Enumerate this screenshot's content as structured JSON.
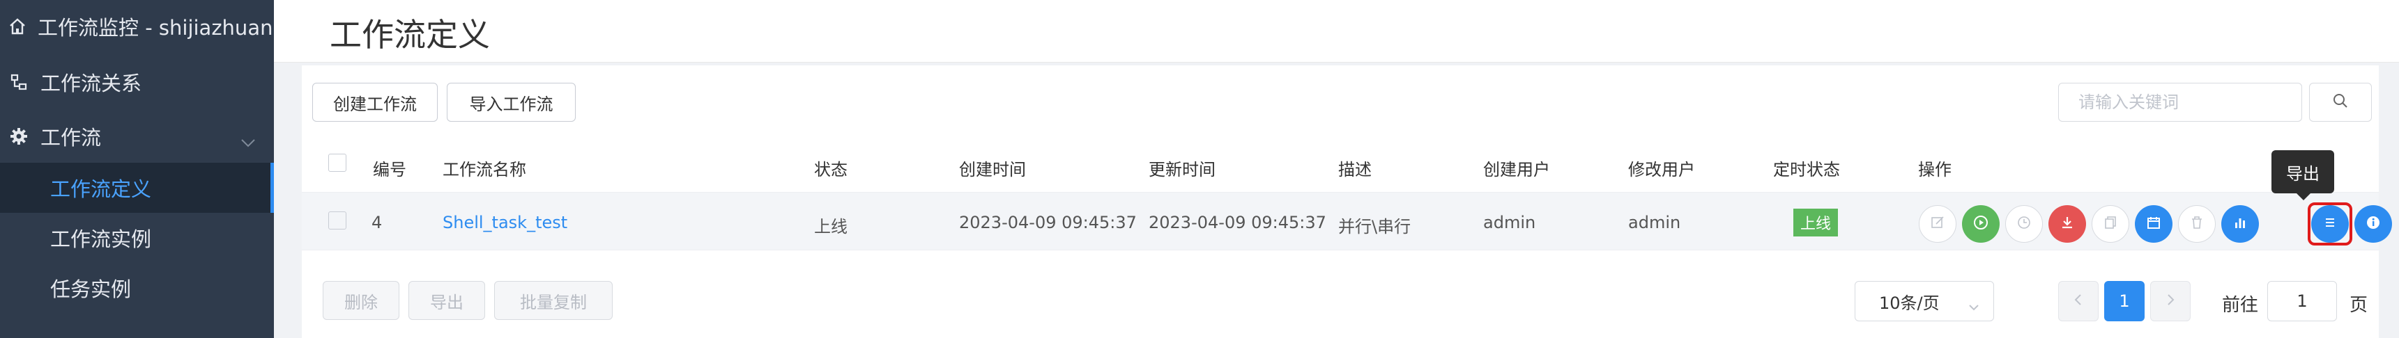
{
  "sidebar": {
    "items": [
      {
        "label": "工作流监控 - shijiazhuan…",
        "icon": "home-icon"
      },
      {
        "label": "工作流关系",
        "icon": "relation-icon"
      },
      {
        "label": "工作流",
        "icon": "gear-icon"
      },
      {
        "label": "工作流定义",
        "active": true
      },
      {
        "label": "工作流实例"
      },
      {
        "label": "任务实例"
      }
    ]
  },
  "page": {
    "title": "工作流定义"
  },
  "toolbar": {
    "create_label": "创建工作流",
    "import_label": "导入工作流",
    "search_placeholder": "请输入关键词"
  },
  "table": {
    "headers": [
      "编号",
      "工作流名称",
      "状态",
      "创建时间",
      "更新时间",
      "描述",
      "创建用户",
      "修改用户",
      "定时状态",
      "操作"
    ],
    "rows": [
      {
        "id": "4",
        "name": "Shell_task_test",
        "status": "上线",
        "created": "2023-04-09 09:45:37",
        "updated": "2023-04-09 09:45:37",
        "description": "并行\\串行",
        "creator": "admin",
        "modifier": "admin",
        "schedule_status": "上线"
      }
    ]
  },
  "actions": {
    "tooltip": "导出",
    "icons": [
      "edit-icon",
      "run-icon",
      "timer-icon",
      "offline-icon",
      "copy-icon",
      "schedule-icon",
      "delete-icon",
      "tree-icon",
      "export-icon",
      "info-icon"
    ],
    "colors": {
      "green": "#5cb85c",
      "red": "#e55353",
      "blue": "#2d8cf0"
    }
  },
  "footer": {
    "delete_label": "删除",
    "export_label": "导出",
    "batch_copy_label": "批量复制",
    "page_size": "10条/页",
    "current_page": "1",
    "goto_prefix": "前往",
    "goto_value": "1",
    "goto_suffix": "页"
  },
  "colors": {
    "sidebar_bg": "#2f3b4c",
    "accent": "#2d8cf0",
    "online_tag": "#5cb85c",
    "highlight": "#e01b1b"
  }
}
